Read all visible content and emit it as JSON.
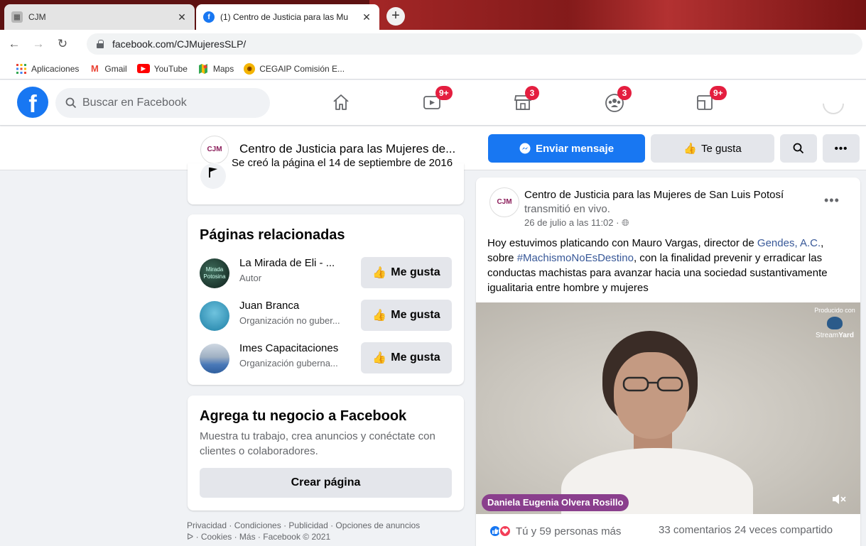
{
  "browser": {
    "tabs": [
      {
        "title": "CJM",
        "active": false
      },
      {
        "title": "(1) Centro de Justicia para las Mu",
        "active": true
      }
    ],
    "new_tab": "+",
    "url": "facebook.com/CJMujeresSLP/",
    "bookmarks": [
      {
        "label": "Aplicaciones",
        "icon": "apps-grid-icon"
      },
      {
        "label": "Gmail",
        "icon": "gmail-icon"
      },
      {
        "label": "YouTube",
        "icon": "youtube-icon"
      },
      {
        "label": "Maps",
        "icon": "maps-icon"
      },
      {
        "label": "CEGAIP Comisión E...",
        "icon": "cegaip-icon"
      }
    ]
  },
  "fb_header": {
    "logo": "f",
    "search_placeholder": "Buscar en Facebook",
    "nav": [
      {
        "name": "home",
        "badge": ""
      },
      {
        "name": "watch",
        "badge": "9+"
      },
      {
        "name": "marketplace",
        "badge": "3"
      },
      {
        "name": "groups",
        "badge": "3"
      },
      {
        "name": "gaming",
        "badge": "9+"
      }
    ]
  },
  "page_bar": {
    "logo_text": "CJM",
    "name": "Centro de Justicia para las Mujeres de...",
    "send_message": "Enviar mensaje",
    "like_label": "Te gusta"
  },
  "info_card": {
    "text": "Se creó la página el 14 de septiembre de 2016"
  },
  "related": {
    "title": "Páginas relacionadas",
    "button_label": "Me gusta",
    "items": [
      {
        "name": "La Mirada de Eli - ...",
        "subtitle": "Autor",
        "avatar_text": "Mirada Potosina"
      },
      {
        "name": "Juan Branca",
        "subtitle": "Organización no guber...",
        "avatar_text": ""
      },
      {
        "name": "Imes Capacitaciones",
        "subtitle": "Organización guberna...",
        "avatar_text": ""
      }
    ]
  },
  "business": {
    "title": "Agrega tu negocio a Facebook",
    "text": "Muestra tu trabajo, crea anuncios y conéctate con clientes o colaboradores.",
    "button": "Crear página"
  },
  "footer": {
    "line1": "Privacidad · Condiciones · Publicidad · Opciones de anuncios",
    "line2": "ᐅ · Cookies · Más · Facebook © 2021"
  },
  "post": {
    "avatar_text": "CJM",
    "author": "Centro de Justicia para las Mujeres de San Luis Potosí",
    "action": "transmitió en vivo.",
    "time": "26 de julio a las 11:02 · ",
    "more": "•••",
    "text_parts": {
      "p1": "Hoy estuvimos platicando con Mauro Vargas, director de ",
      "link1": "Gendes, A.C.",
      "p2": ", sobre ",
      "link2": "#MachismoNoEsDestino",
      "p3": ", con la finalidad prevenir y erradicar las conductas machistas para avanzar hacia una sociedad sustantivamente igualitaria entre hombre y mujeres"
    },
    "video": {
      "produced_with": "Producido con",
      "stream_brand_a": "Stream",
      "stream_brand_b": "Yard",
      "speaker_tag": "Daniela Eugenia Olvera Rosillo"
    },
    "reactions_text": "Tú y 59 personas más",
    "stats": "33 comentarios  24 veces compartido"
  },
  "colors": {
    "facebook_blue": "#1877f2",
    "badge_red": "#e41e3f",
    "page_bg": "#f0f2f5",
    "name_tag_purple": "#8a3f8d"
  }
}
